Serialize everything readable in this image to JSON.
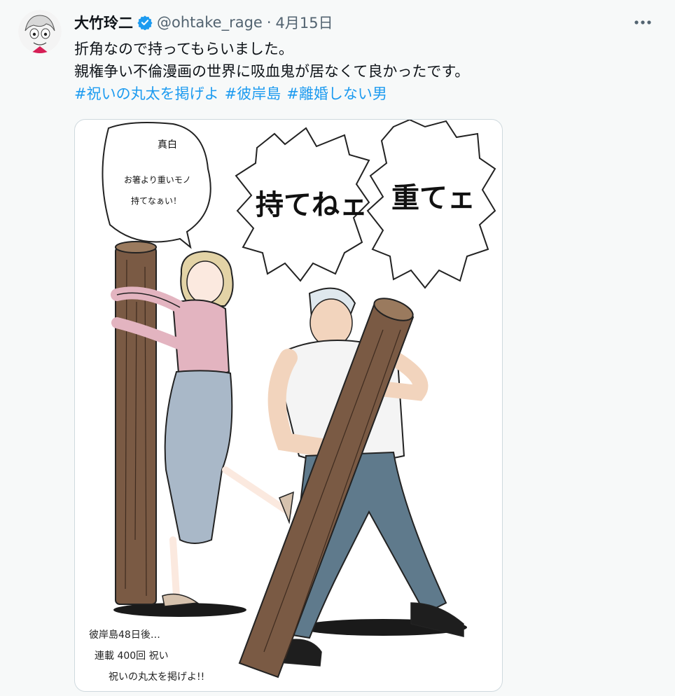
{
  "tweet": {
    "author_name": "大竹玲二",
    "handle": "@ohtake_rage",
    "separator": "·",
    "date": "4月15日",
    "verified": true,
    "lines": [
      "折角なので持ってもらいました。",
      "親権争い不倫漫画の世界に吸血鬼が居なくて良かったです。"
    ],
    "hashtags": [
      "#祝いの丸太を掲げよ",
      "#彼岸島",
      "#離婚しない男"
    ]
  },
  "image": {
    "bubble_small": [
      "真白",
      "お箸より重いモノ",
      "持てなぁい！"
    ],
    "bubble_left": "持てねェ",
    "bubble_right": "重てェ",
    "caption": [
      "彼岸島48日後…",
      "連載 400回 祝い",
      "祝いの丸太を掲げよ!!"
    ]
  },
  "colors": {
    "accent": "#1d9bf0",
    "verified": "#1d9bf0",
    "secondary_text": "#536471",
    "log": "#7a5a44",
    "blouse": "#e3b4c0",
    "skirt": "#a9b8c8",
    "jeans": "#5f7a8c"
  },
  "icons": {
    "verified": "verified-badge-icon",
    "more": "more-horizontal-icon"
  }
}
